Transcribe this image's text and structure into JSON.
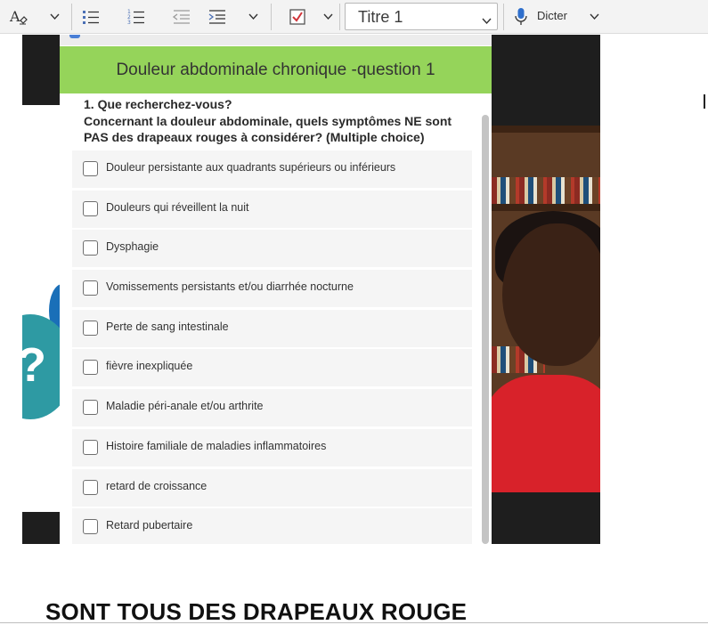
{
  "toolbar": {
    "style_value": "Titre 1",
    "dictate_label": "Dicter",
    "accent_color": "#d0343a",
    "icons": [
      "text-effects-icon",
      "bullet-list-icon",
      "numbered-list-icon",
      "decrease-indent-icon",
      "increase-indent-icon",
      "checkbox-icon",
      "microphone-icon"
    ]
  },
  "poll": {
    "title": "Douleur abdominale chronique -question 1",
    "question_line1": "1. Que recherchez-vous?",
    "question_line2": "Concernant la douleur abdominale, quels symptômes NE sont PAS des drapeaux rouges à considérer? (Multiple choice)",
    "banner_color": "#95d45a",
    "options": [
      "Douleur persistante aux quadrants supérieurs ou inférieurs",
      "Douleurs qui réveillent la nuit",
      "Dysphagie",
      "Vomissements persistants et/ou diarrhée nocturne",
      "Perte de sang intestinale",
      "fièvre inexpliquée",
      "Maladie péri-anale et/ou arthrite",
      "Histoire familiale de maladies inflammatoires",
      "retard de croissance",
      "Retard pubertaire"
    ]
  },
  "document": {
    "heading": "SONT TOUS DES DRAPEAUX ROUGE"
  }
}
